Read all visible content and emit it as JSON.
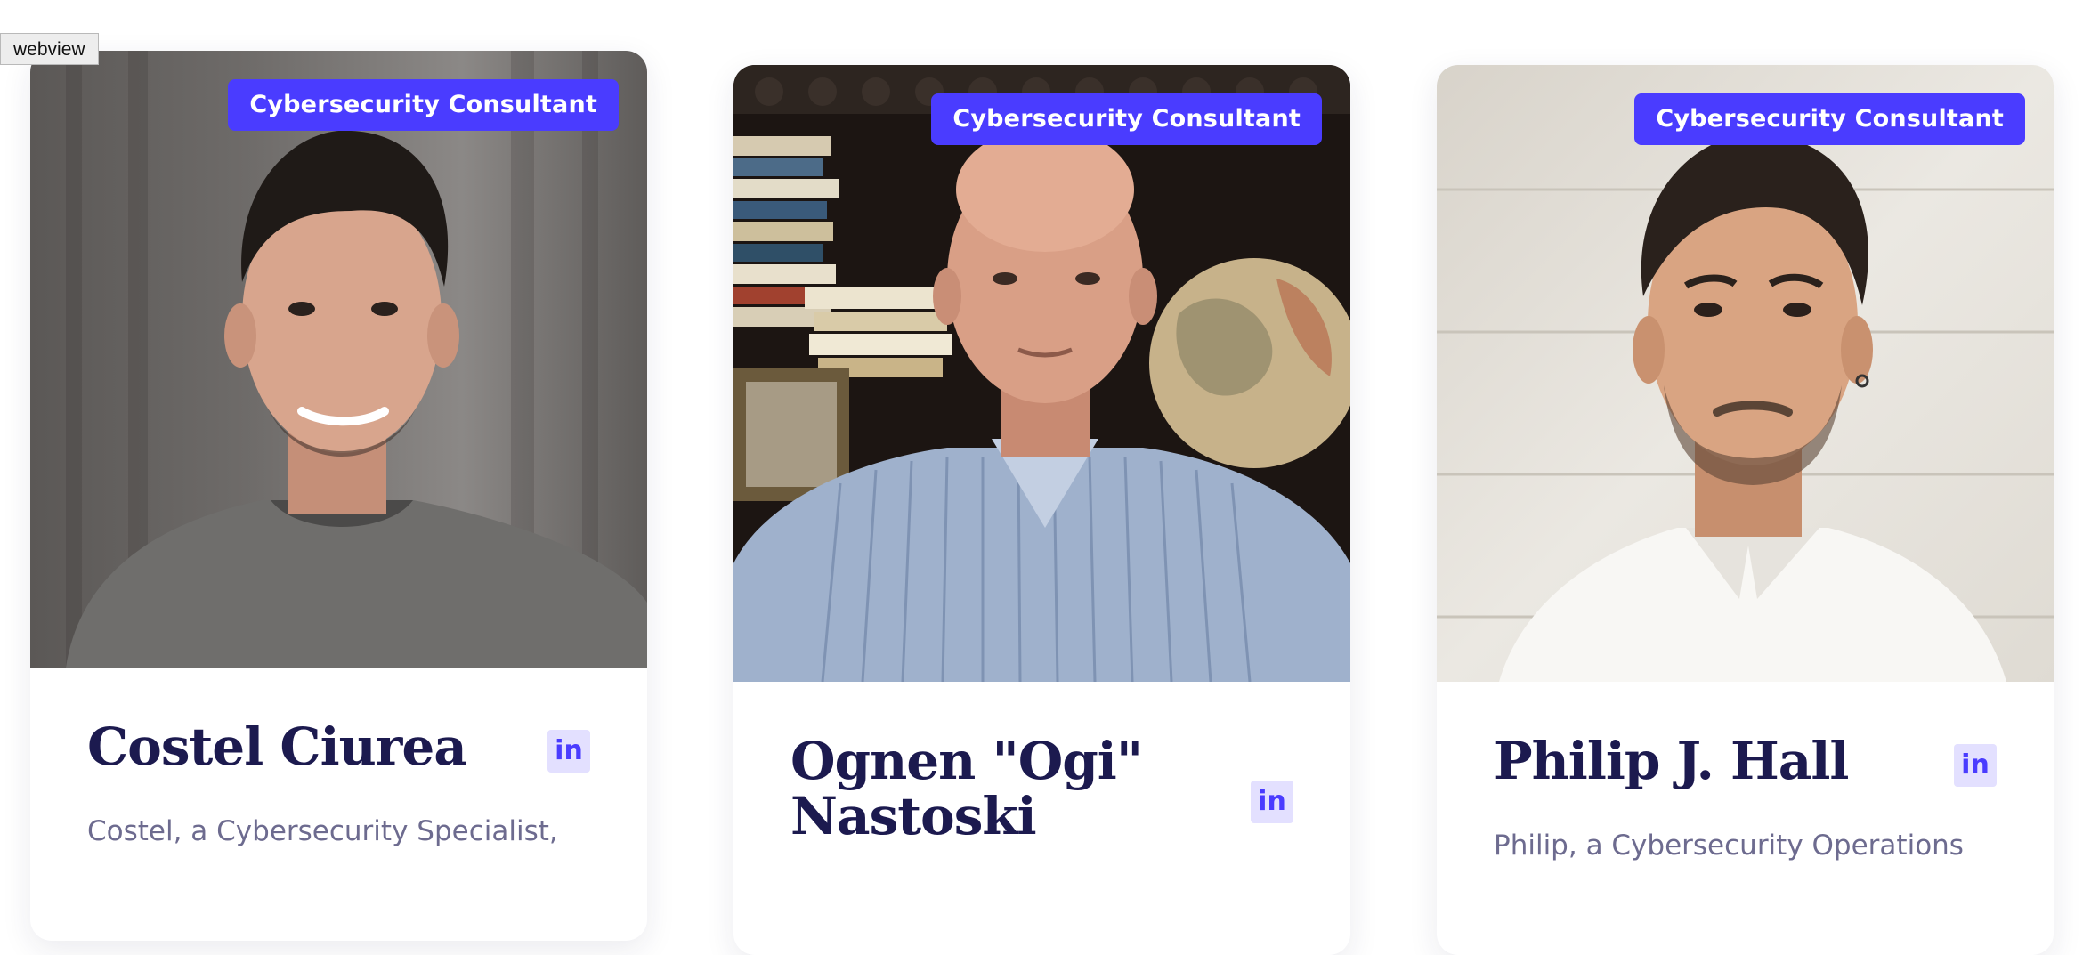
{
  "webview_label": "webview",
  "cards": [
    {
      "role": "Cybersecurity Consultant",
      "name": "Costel Ciurea",
      "linkedin_label": "in",
      "bio": "Costel, a Cybersecurity Specialist,"
    },
    {
      "role": "Cybersecurity Consultant",
      "name": "Ognen \"Ogi\" Nastoski",
      "linkedin_label": "in",
      "bio": ""
    },
    {
      "role": "Cybersecurity Consultant",
      "name": "Philip J. Hall",
      "linkedin_label": "in",
      "bio": "Philip, a Cybersecurity Operations"
    }
  ],
  "colors": {
    "accent": "#4a3cff",
    "name_text": "#1c1a4f",
    "bio_text": "#6d6b8f",
    "linkedin_bg": "#e3e0ff"
  },
  "icons": [
    "linkedin-icon"
  ]
}
